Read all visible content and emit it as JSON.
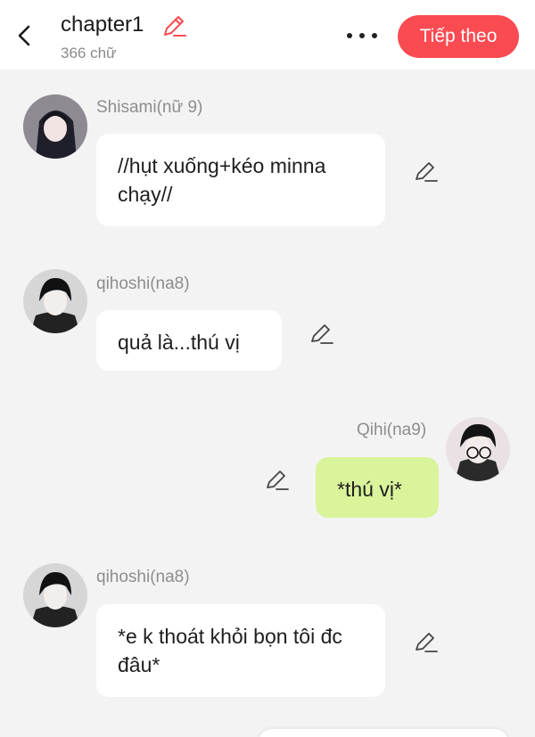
{
  "header": {
    "title": "chapter1",
    "word_count": "366 chữ",
    "next_label": "Tiếp theo",
    "accent_color": "#fa4a52"
  },
  "messages": [
    {
      "speaker": "Shisami(nữ 9)",
      "text": "//hụt xuống+kéo minna chạy//",
      "side": "left"
    },
    {
      "speaker": "qihoshi(na8)",
      "text": "quả là...thú vị",
      "side": "left"
    },
    {
      "speaker": "Qihi(na9)",
      "text": "*thú vị*",
      "side": "right"
    },
    {
      "speaker": "qihoshi(na8)",
      "text": "*e k thoát khỏi bọn tôi đc đâu*",
      "side": "left"
    }
  ],
  "colors": {
    "bubble_right": "#d9f49b",
    "bubble_left": "#ffffff",
    "background": "#f3f3f3"
  },
  "icons": [
    "back-arrow-icon",
    "pencil-icon",
    "more-dots-icon",
    "avatar-image"
  ]
}
